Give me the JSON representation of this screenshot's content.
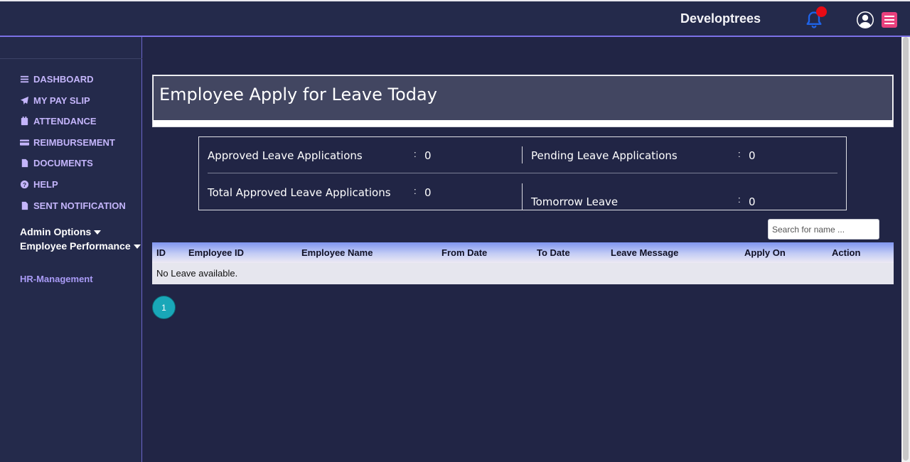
{
  "header": {
    "brand": "Developtrees",
    "notification_icon": "bell-icon",
    "profile_icon": "user-circle-icon",
    "menu_icon": "hamburger-icon",
    "accent_color": "#e8407d",
    "notification_dot_color": "#e80b14"
  },
  "sidebar": {
    "items": [
      {
        "label": "DASHBOARD",
        "icon": "list-icon"
      },
      {
        "label": "MY PAY SLIP",
        "icon": "paper-plane-icon"
      },
      {
        "label": "ATTENDANCE",
        "icon": "calendar-icon"
      },
      {
        "label": "REIMBURSEMENT",
        "icon": "credit-card-icon"
      },
      {
        "label": "DOCUMENTS",
        "icon": "file-icon"
      },
      {
        "label": "HELP",
        "icon": "question-circle-icon"
      },
      {
        "label": "SENT NOTIFICATION",
        "icon": "file-icon"
      }
    ],
    "admin_options": "Admin Options",
    "employee_performance": "Employee Performance",
    "hr_management": "HR-Management"
  },
  "main": {
    "title": "Employee Apply for Leave Today",
    "stats": {
      "approved_label": "Approved Leave Applications",
      "approved_value": "0",
      "pending_label": "Pending Leave Applications",
      "pending_value": "0",
      "total_approved_label": "Total Approved Leave Applications",
      "total_approved_value": "0",
      "tomorrow_label": "Tomorrow Leave",
      "tomorrow_value": "0",
      "separator": ":"
    },
    "search": {
      "placeholder": "Search for name ..."
    },
    "table": {
      "headers": [
        "ID",
        "Employee ID",
        "Employee Name",
        "From Date",
        "To Date",
        "Leave Message",
        "Apply On",
        "Action"
      ],
      "empty_message": "No Leave available."
    },
    "pagination": {
      "current_page": "1"
    }
  }
}
